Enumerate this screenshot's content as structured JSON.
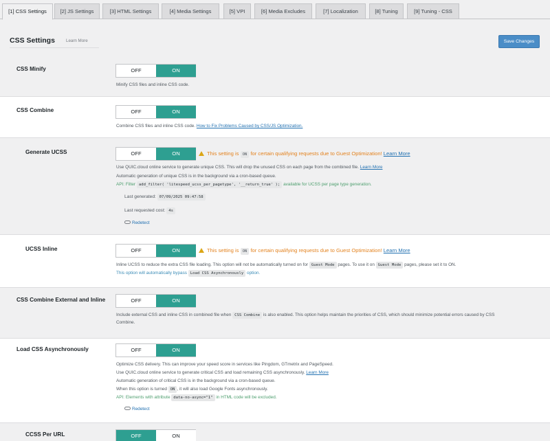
{
  "tabs": [
    {
      "label": "[1] CSS Settings",
      "active": true
    },
    {
      "label": "[2] JS Settings"
    },
    {
      "label": "[3] HTML Settings"
    },
    {
      "label": "[4] Media Settings"
    },
    {
      "label": "[5] VPI"
    },
    {
      "label": "[6] Media Excludes"
    },
    {
      "label": "[7] Localization"
    },
    {
      "label": "[8] Tuning"
    },
    {
      "label": "[9] Tuning - CSS"
    }
  ],
  "header": {
    "title": "CSS Settings",
    "learn_more": "Learn More",
    "save": "Save Changes"
  },
  "toggle": {
    "off": "OFF",
    "on": "ON"
  },
  "settings": {
    "css_minify": {
      "label": "CSS Minify",
      "state": "ON",
      "desc": "Minify CSS files and inline CSS code."
    },
    "css_combine": {
      "label": "CSS Combine",
      "state": "ON",
      "desc_pre": "Combine CSS files and inline CSS code.",
      "desc_link": "How to Fix Problems Caused by CSS/JS Optimization."
    },
    "generate_ucss": {
      "label": "Generate UCSS",
      "state": "ON",
      "warn_pre": "This setting is",
      "warn_code": "ON",
      "warn_post": "for certain qualifying requests due to Guest Optimization!",
      "warn_link": "Learn More",
      "desc1_pre": "Use QUIC.cloud online service to generate unique CSS. This will drop the unused CSS on each page from the combined file.",
      "desc1_link": "Learn More",
      "desc2": "Automatic generation of unique CSS is in the background via a cron-based queue.",
      "api_pre": "API: Filter",
      "api_code": "add_filter( 'litespeed_ucss_per_pagetype', '__return_true' );",
      "api_post": "available for UCSS per page type generation.",
      "last_generated_label": "Last generated:",
      "last_generated_value": "07/09/2025 09:47:58",
      "last_cost_label": "Last requested cost:",
      "last_cost_value": "4s",
      "redetect": "Redetect"
    },
    "ucss_inline": {
      "label": "UCSS Inline",
      "state": "ON",
      "warn_pre": "This setting is",
      "warn_code": "ON",
      "warn_post": "for certain qualifying requests due to Guest Optimization!",
      "warn_link": "Learn More",
      "desc_pre": "Inline UCSS to reduce the extra CSS file loading. This option will not be automatically turned on for",
      "desc_code1": "Guest Mode",
      "desc_mid": "pages. To use it on",
      "desc_code2": "Guest Mode",
      "desc_post": "pages, please set it to ON.",
      "note_pre": "This option will automatically bypass",
      "note_code": "Load CSS Asynchronously",
      "note_post": "option."
    },
    "css_combine_external": {
      "label": "CSS Combine External and Inline",
      "state": "ON",
      "desc_pre": "Include external CSS and inline CSS in combined file when",
      "desc_code": "CSS Combine",
      "desc_post": "is also enabled. This option helps maintain the priorities of CSS, which should minimize potential errors caused by CSS",
      "desc_line2": "Combine."
    },
    "load_css_async": {
      "label": "Load CSS Asynchronously",
      "state": "ON",
      "desc1": "Optimize CSS delivery. This can improve your speed score in services like Pingdom, GTmetrix and PageSpeed.",
      "desc2_pre": "Use QUIC.cloud online service to generate critical CSS and load remaining CSS asynchronously.",
      "desc2_link": "Learn More",
      "desc3": "Automatic generation of critical CSS is in the background via a cron-based queue.",
      "desc4_pre": "When this option is turned",
      "desc4_code": "ON",
      "desc4_post": ", it will also load Google Fonts asynchronously.",
      "api_pre": "API: Elements with attribute",
      "api_code": "data-no-async=\"1\"",
      "api_post": "in HTML code will be excluded.",
      "redetect": "Redetect"
    },
    "ccss_per_url": {
      "label": "CCSS Per URL",
      "state": "OFF"
    }
  },
  "colors": {
    "toggle_active": "#2e9f91",
    "save_button": "#4a8dc7",
    "warning": "#e3821e",
    "link": "#2271b1",
    "api_green": "#4d9e6e"
  }
}
